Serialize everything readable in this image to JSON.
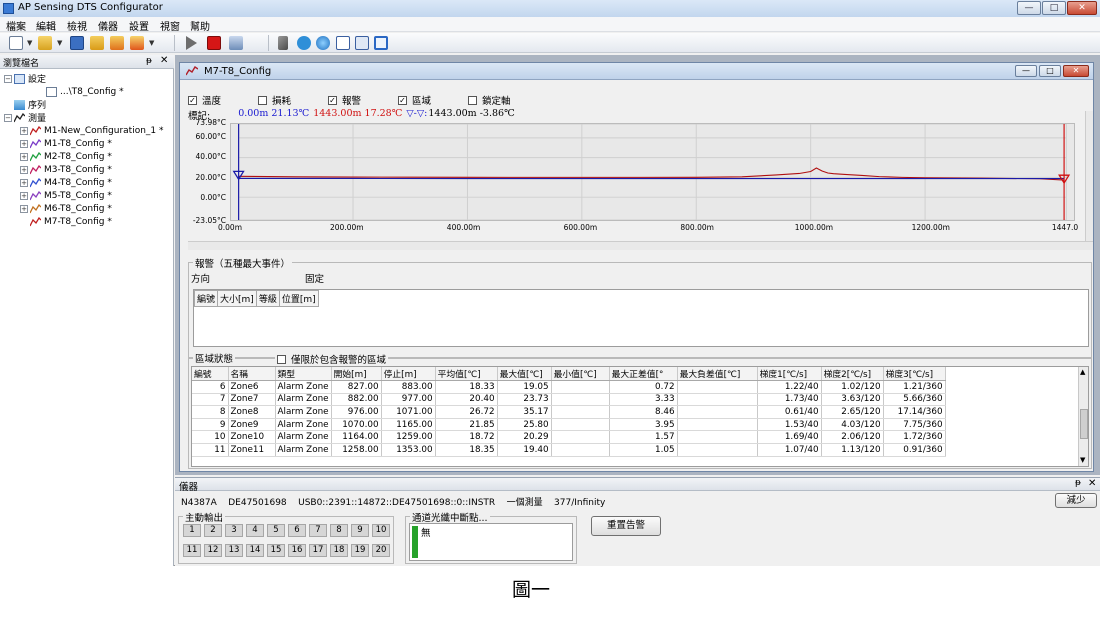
{
  "app": {
    "title": "AP Sensing DTS Configurator"
  },
  "window_controls": {
    "minimize": "—",
    "maximize": "□",
    "close": "✕"
  },
  "menu": [
    "檔案",
    "編輯",
    "檢視",
    "儀器",
    "設置",
    "視窗",
    "幫助"
  ],
  "toolbar_icons": [
    "new-icon",
    "open-icon",
    "save-icon",
    "copy-icon",
    "delete-icon",
    "wizard-icon",
    "play-icon",
    "stop-icon",
    "export-icon",
    "wrench-icon",
    "settings-icon",
    "globe-icon",
    "chart-icon",
    "panel-icon",
    "window-icon"
  ],
  "browser": {
    "title": "瀏覽檔名",
    "pin": "ᵽ",
    "close": "✕",
    "tree": [
      {
        "label": "設定",
        "indent": 0,
        "expander": "−",
        "icon": "config-icon"
      },
      {
        "label": "...\\T8_Config *",
        "indent": 2,
        "expander": "",
        "icon": "document-icon"
      },
      {
        "label": "序列",
        "indent": 0,
        "expander": "",
        "icon": "sequence-icon"
      },
      {
        "label": "測量",
        "indent": 0,
        "expander": "−",
        "icon": "measurement-icon"
      },
      {
        "label": "M1-New_Configuration_1 *",
        "indent": 1,
        "expander": "+",
        "icon": "trace-icon"
      },
      {
        "label": "M1-T8_Config *",
        "indent": 1,
        "expander": "+",
        "icon": "trace-icon"
      },
      {
        "label": "M2-T8_Config *",
        "indent": 1,
        "expander": "+",
        "icon": "trace-icon"
      },
      {
        "label": "M3-T8_Config *",
        "indent": 1,
        "expander": "+",
        "icon": "trace-icon"
      },
      {
        "label": "M4-T8_Config *",
        "indent": 1,
        "expander": "+",
        "icon": "trace-icon"
      },
      {
        "label": "M5-T8_Config *",
        "indent": 1,
        "expander": "+",
        "icon": "trace-icon"
      },
      {
        "label": "M6-T8_Config *",
        "indent": 1,
        "expander": "+",
        "icon": "trace-icon"
      },
      {
        "label": "M7-T8_Config *",
        "indent": 1,
        "expander": "",
        "icon": "trace-icon"
      }
    ]
  },
  "child": {
    "title": "M7-T8_Config",
    "controls": {
      "minimize": "—",
      "maximize": "□",
      "close": "✕"
    },
    "checkboxes": [
      {
        "label": "溫度",
        "checked": true
      },
      {
        "label": "損耗",
        "checked": false
      },
      {
        "label": "報警",
        "checked": true
      },
      {
        "label": "區域",
        "checked": true
      },
      {
        "label": "鎖定軸",
        "checked": false
      }
    ],
    "markers": {
      "label": "標記:",
      "blue": "0.00m 21.13℃",
      "red": "1443.00m 17.28℃",
      "delta_sym": "▽-▽:",
      "delta": "1443.00m -3.86℃"
    }
  },
  "chart_data": {
    "type": "line",
    "title": "",
    "xlabel": "",
    "ylabel": "",
    "xlim": [
      0,
      1447
    ],
    "ylim": [
      -23.05,
      73.98
    ],
    "ytick_labels": [
      "73.98°C",
      "60.00°C",
      "40.00°C",
      "20.00°C",
      "0.00°C",
      "-23.05°C"
    ],
    "yticks": [
      73.98,
      60,
      40,
      20,
      0,
      -23.05
    ],
    "xtick_labels": [
      "0.00m",
      "200.00m",
      "400.00m",
      "600.00m",
      "800.00m",
      "1000.00m",
      "1200.00m",
      "1447.0"
    ],
    "xticks": [
      0,
      200,
      400,
      600,
      800,
      1000,
      1200,
      1447
    ],
    "series": [
      {
        "color": "#b01010",
        "x": [
          0,
          100,
          200,
          300,
          400,
          500,
          600,
          700,
          800,
          880,
          940,
          980,
          1000,
          1010,
          1020,
          1030,
          1040,
          1060,
          1090,
          1120,
          1160,
          1200,
          1300,
          1400,
          1443
        ],
        "values": [
          21.1,
          20.6,
          20.3,
          20.2,
          20.1,
          20.0,
          20.0,
          20.0,
          20.1,
          20.6,
          22.5,
          24.0,
          26.0,
          29.5,
          26.5,
          24.5,
          23.8,
          23.0,
          22.0,
          20.8,
          20.0,
          19.6,
          19.2,
          18.6,
          17.3
        ]
      },
      {
        "color": "#1a1aa8",
        "x": [
          0,
          200,
          400,
          600,
          800,
          1000,
          1200,
          1443
        ],
        "values": [
          18.9,
          18.9,
          18.8,
          18.8,
          18.8,
          18.8,
          18.8,
          18.8
        ]
      }
    ],
    "markers": [
      {
        "x": 0,
        "color": "#1a1aa8"
      },
      {
        "x": 1443,
        "color": "#d01010"
      }
    ],
    "grid": true
  },
  "alarms": {
    "title": "報警（五種最大事件）",
    "direction_label": "方向",
    "direction_value": "固定",
    "columns": [
      "編號",
      "大小[m]",
      "等級",
      "位置[m]"
    ]
  },
  "zones": {
    "title": "區域狀態",
    "filter_label": "僅限於包含報警的區域",
    "columns": [
      "編號",
      "名稱",
      "類型",
      "開始[m]",
      "停止[m]",
      "平均值[℃]",
      "最大值[℃]",
      "最小值[℃]",
      "最大正差值[°",
      "最大負差值[℃]",
      "梯度1[℃/s]",
      "梯度2[℃/s]",
      "梯度3[℃/s]"
    ],
    "rows": [
      [
        "6",
        "Zone6",
        "Alarm Zone",
        "827.00",
        "883.00",
        "18.33",
        "19.05",
        "",
        "0.72",
        "",
        "1.22/40",
        "1.02/120",
        "1.21/360"
      ],
      [
        "7",
        "Zone7",
        "Alarm Zone",
        "882.00",
        "977.00",
        "20.40",
        "23.73",
        "",
        "3.33",
        "",
        "1.73/40",
        "3.63/120",
        "5.66/360"
      ],
      [
        "8",
        "Zone8",
        "Alarm Zone",
        "976.00",
        "1071.00",
        "26.72",
        "35.17",
        "",
        "8.46",
        "",
        "0.61/40",
        "2.65/120",
        "17.14/360"
      ],
      [
        "9",
        "Zone9",
        "Alarm Zone",
        "1070.00",
        "1165.00",
        "21.85",
        "25.80",
        "",
        "3.95",
        "",
        "1.53/40",
        "4.03/120",
        "7.75/360"
      ],
      [
        "10",
        "Zone10",
        "Alarm Zone",
        "1164.00",
        "1259.00",
        "18.72",
        "20.29",
        "",
        "1.57",
        "",
        "1.69/40",
        "2.06/120",
        "1.72/360"
      ],
      [
        "11",
        "Zone11",
        "Alarm Zone",
        "1258.00",
        "1353.00",
        "18.35",
        "19.40",
        "",
        "1.05",
        "",
        "1.07/40",
        "1.13/120",
        "0.91/360"
      ]
    ]
  },
  "instrument": {
    "title": "儀器",
    "pin": "ᵽ",
    "close": "✕",
    "info": "N4387A    DE47501698    USB0::2391::14872::DE47501698::0::INSTR    一個測量    377/Infinity",
    "reduce_label": "減少",
    "active_output_label": "主動輸出",
    "channels": [
      "1",
      "2",
      "3",
      "4",
      "5",
      "6",
      "7",
      "8",
      "9",
      "10",
      "11",
      "12",
      "13",
      "14",
      "15",
      "16",
      "17",
      "18",
      "19",
      "20"
    ],
    "fiber_break_label": "通道光纖中斷點...",
    "fiber_break_value": "無",
    "reset_alarm_label": "重置告警"
  },
  "caption": "圖一"
}
